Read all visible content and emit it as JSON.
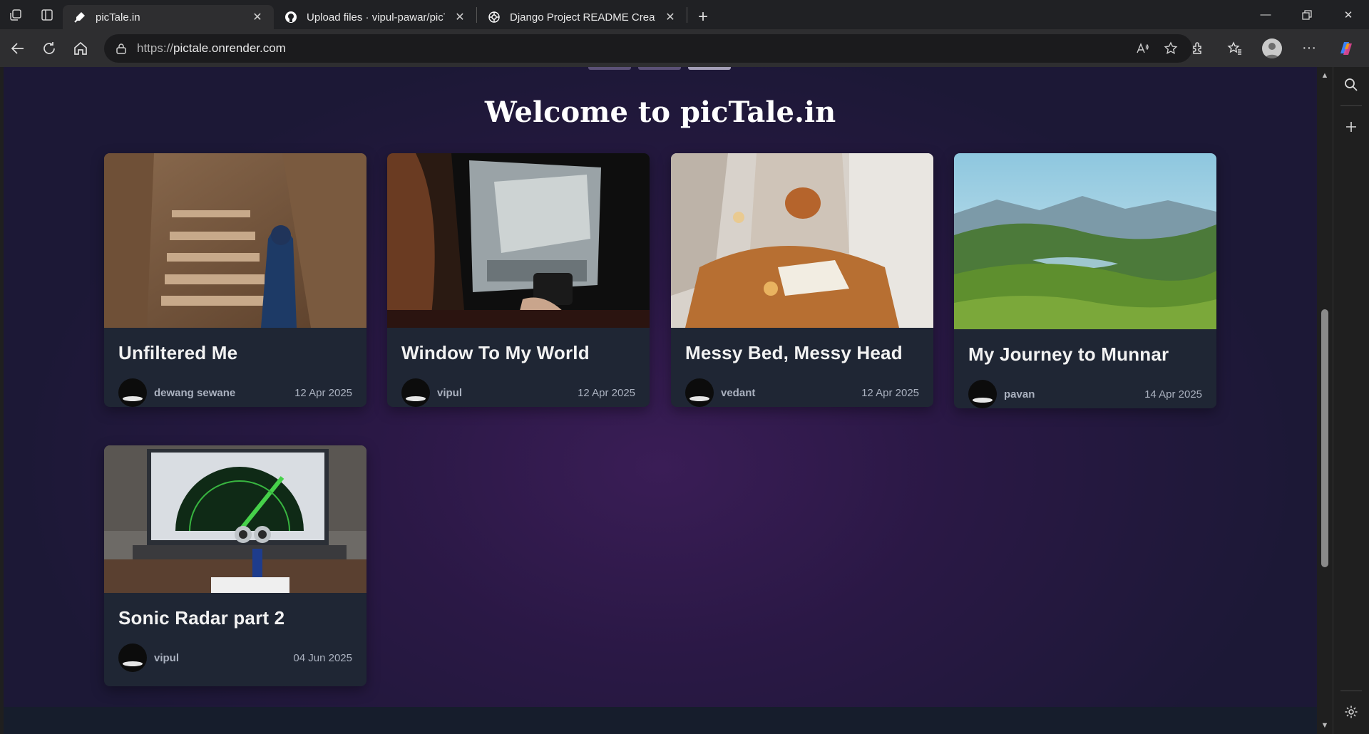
{
  "browser": {
    "tabs": [
      {
        "title": "picTale.in",
        "active": true,
        "favicon": "pictale-favicon"
      },
      {
        "title": "Upload files · vipul-pawar/picTale",
        "active": false,
        "favicon": "github-icon"
      },
      {
        "title": "Django Project README Creation",
        "active": false,
        "favicon": "chatgpt-icon"
      }
    ],
    "url_scheme": "https://",
    "url_host": "pictale.onrender.com"
  },
  "page": {
    "heading": "Welcome to picTale.in",
    "colors": {
      "bg_top": "#1c1836",
      "bg_center": "#3a1d56",
      "card_bg": "#1f2634",
      "meta_text": "#aab1bf"
    },
    "posts": [
      {
        "title": "Unfiltered Me",
        "author": "dewang sewane",
        "date": "12 Apr 2025",
        "image": "desert-steps-photo"
      },
      {
        "title": "Window To My World",
        "author": "vipul",
        "date": "12 Apr 2025",
        "image": "window-coffee-photo"
      },
      {
        "title": "Messy Bed, Messy Head",
        "author": "vedant",
        "date": "12 Apr 2025",
        "image": "bed-book-photo"
      },
      {
        "title": "My Journey to Munnar",
        "author": "pavan",
        "date": "14 Apr 2025",
        "image": "munnar-landscape-photo"
      },
      {
        "title": "Sonic Radar part 2",
        "author": "vipul",
        "date": "04 Jun 2025",
        "image": "radar-arduino-photo"
      }
    ]
  }
}
